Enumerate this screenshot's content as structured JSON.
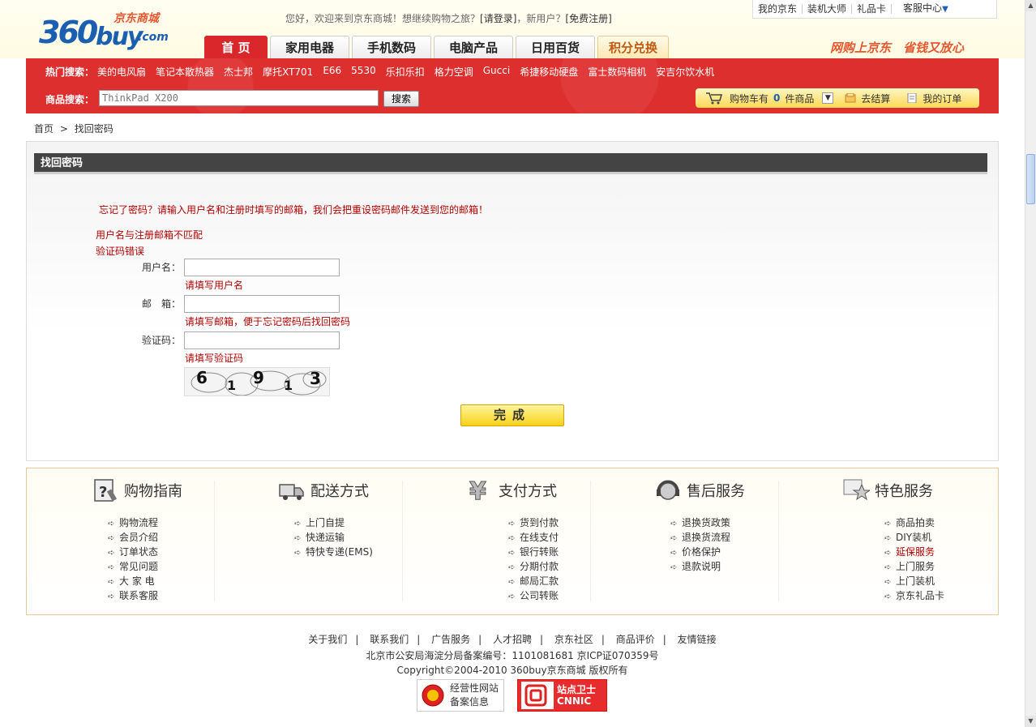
{
  "header": {
    "logo_num": "360",
    "logo_buy": "buy",
    "logo_com": ".com",
    "logo_cn": "京东商城",
    "welcome_pre": "您好，欢迎来到京东商城！想继续购物之旅？",
    "login": "[请登录]",
    "welcome_mid": "，新用户？",
    "register": "[免费注册]",
    "toplinks": [
      "我的京东",
      "装机大师",
      "礼品卡",
      "客服中心"
    ],
    "slogan": "网购上京东　省钱又放心"
  },
  "nav": {
    "tabs": [
      {
        "label": "首 页",
        "width": 78
      },
      {
        "label": "家用电器",
        "width": 98
      },
      {
        "label": "手机数码",
        "width": 98
      },
      {
        "label": "电脑产品",
        "width": 98
      },
      {
        "label": "日用百货",
        "width": 98
      },
      {
        "label": "积分兑换",
        "width": 88
      }
    ]
  },
  "hot_search": {
    "label": "热门搜索：",
    "keywords": [
      "美的电风扇",
      "笔记本散热器",
      "杰士邦",
      "摩托XT701",
      "E66",
      "5530",
      "乐扣乐扣",
      "格力空调",
      "Gucci",
      "希捷移动硬盘",
      "富士数码相机",
      "安吉尔饮水机"
    ]
  },
  "search": {
    "label": "商品搜索：",
    "value": "ThinkPad X200",
    "button": "搜索"
  },
  "cart": {
    "pre": "购物车有",
    "count": "0",
    "post": "件商品",
    "checkout": "去结算",
    "orders": "我的订单"
  },
  "breadcrumb": {
    "home": "首页",
    "sep": ">",
    "current": "找回密码"
  },
  "form": {
    "title": "找回密码",
    "intro": "忘记了密码？请输入用户名和注册时填写的邮箱，我们会把重设密码邮件发送到您的邮箱！",
    "error1": "用户名与注册邮箱不匹配",
    "error2": "验证码错误",
    "username_label": "用户名：",
    "username_hint": "请填写用户名",
    "email_label": "邮　箱：",
    "email_hint": "请填写邮箱，便于忘记密码后找回密码",
    "captcha_label": "验证码：",
    "captcha_hint": "请填写验证码",
    "captcha_text": [
      "6",
      "1",
      "9",
      "1",
      "3"
    ],
    "submit": "完成"
  },
  "services": [
    {
      "title": "购物指南",
      "icon": "question-icon",
      "items": [
        "购物流程",
        "会员介绍",
        "订单状态",
        "常见问题",
        "大 家 电",
        "联系客服"
      ]
    },
    {
      "title": "配送方式",
      "icon": "truck-icon",
      "items": [
        "上门自提",
        "快递运输",
        "特快专递(EMS)"
      ]
    },
    {
      "title": "支付方式",
      "icon": "yen-icon",
      "items": [
        "货到付款",
        "在线支付",
        "银行转账",
        "分期付款",
        "邮局汇款",
        "公司转账"
      ]
    },
    {
      "title": "售后服务",
      "icon": "headset-icon",
      "items": [
        "退换货政策",
        "退换货流程",
        "价格保护",
        "退款说明"
      ]
    },
    {
      "title": "特色服务",
      "icon": "star-icon",
      "items": [
        "商品拍卖",
        "DIY装机",
        "延保服务",
        "上门服务",
        "上门装机",
        "京东礼品卡"
      ]
    }
  ],
  "footer": {
    "links": [
      "关于我们",
      "联系我们",
      "广告服务",
      "人才招聘",
      "京东社区",
      "商品评价",
      "友情链接"
    ],
    "beian": "北京市公安局海淀分局备案编号：1101081681 京ICP证070359号",
    "copyright": "Copyright©2004-2010  360buy京东商城 版权所有",
    "badge1": [
      "经营性网站",
      "备案信息"
    ],
    "badge2": [
      "站点卫士",
      "CNNIC"
    ]
  },
  "colors": {
    "brand_red": "#de2f2f",
    "link_blue": "#1a5fb0",
    "error_red": "#b30000",
    "accent_orange": "#e4572e"
  }
}
